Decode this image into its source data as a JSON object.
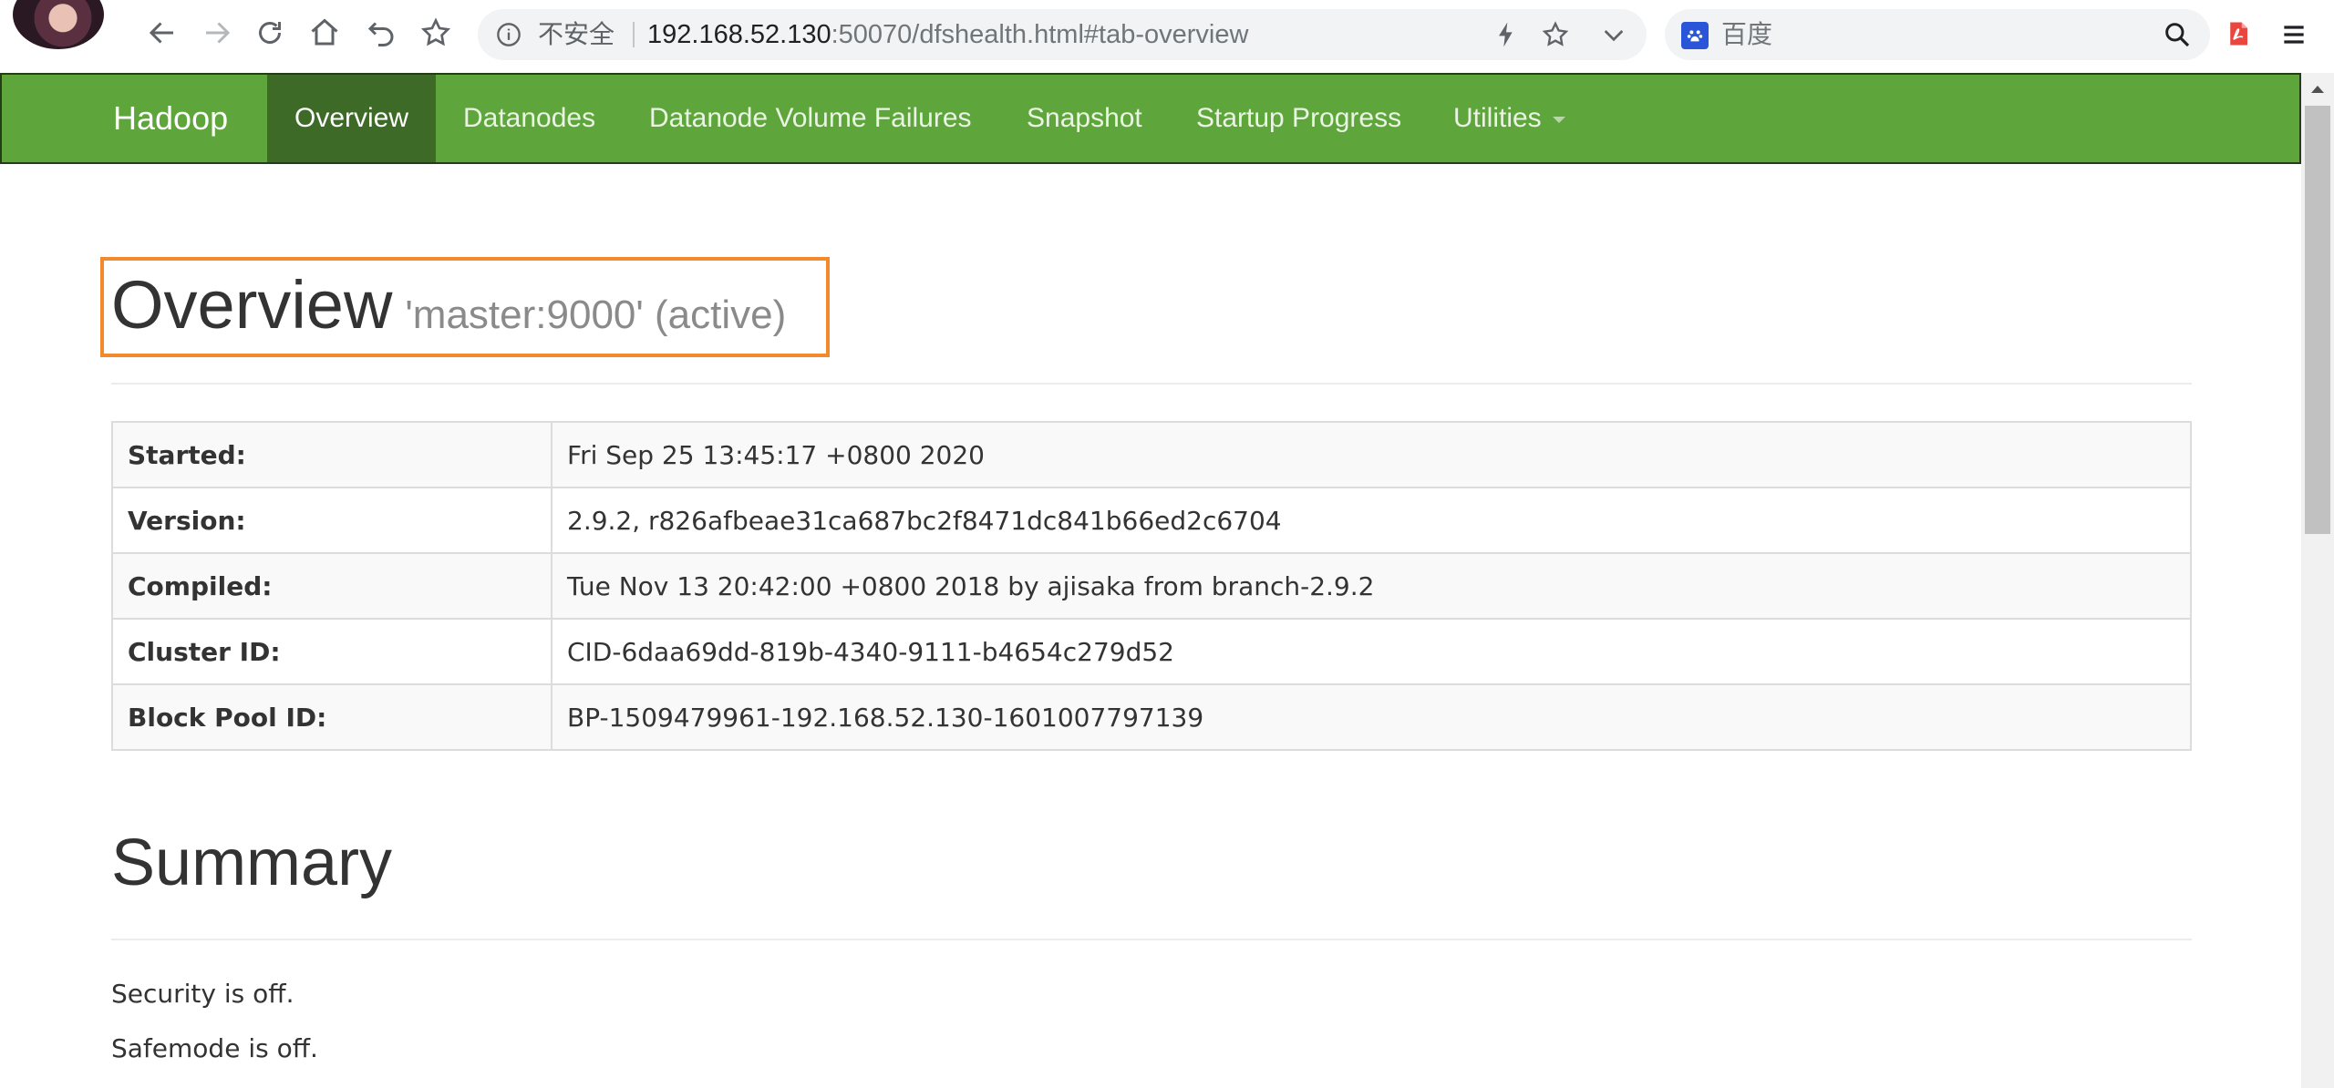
{
  "browser": {
    "address": {
      "security_label": "不安全",
      "url_host": "192.168.52.130",
      "url_rest": ":50070/dfshealth.html#tab-overview"
    },
    "search": {
      "placeholder": "百度"
    }
  },
  "navbar": {
    "brand": "Hadoop",
    "items": [
      {
        "label": "Overview",
        "active": true
      },
      {
        "label": "Datanodes",
        "active": false
      },
      {
        "label": "Datanode Volume Failures",
        "active": false
      },
      {
        "label": "Snapshot",
        "active": false
      },
      {
        "label": "Startup Progress",
        "active": false
      },
      {
        "label": "Utilities",
        "active": false,
        "dropdown": true
      }
    ]
  },
  "overview": {
    "title": "Overview",
    "subtitle": "'master:9000' (active)",
    "rows": [
      {
        "key": "Started:",
        "value": "Fri Sep 25 13:45:17 +0800 2020"
      },
      {
        "key": "Version:",
        "value": "2.9.2, r826afbeae31ca687bc2f8471dc841b66ed2c6704"
      },
      {
        "key": "Compiled:",
        "value": "Tue Nov 13 20:42:00 +0800 2018 by ajisaka from branch-2.9.2"
      },
      {
        "key": "Cluster ID:",
        "value": "CID-6daa69dd-819b-4340-9111-b4654c279d52"
      },
      {
        "key": "Block Pool ID:",
        "value": "BP-1509479961-192.168.52.130-1601007797139"
      }
    ]
  },
  "summary": {
    "title": "Summary",
    "security": "Security is off.",
    "safemode": "Safemode is off."
  },
  "colors": {
    "navbar_bg": "#5ea53c",
    "navbar_active": "#3d6b27",
    "highlight": "#f08a2c"
  }
}
